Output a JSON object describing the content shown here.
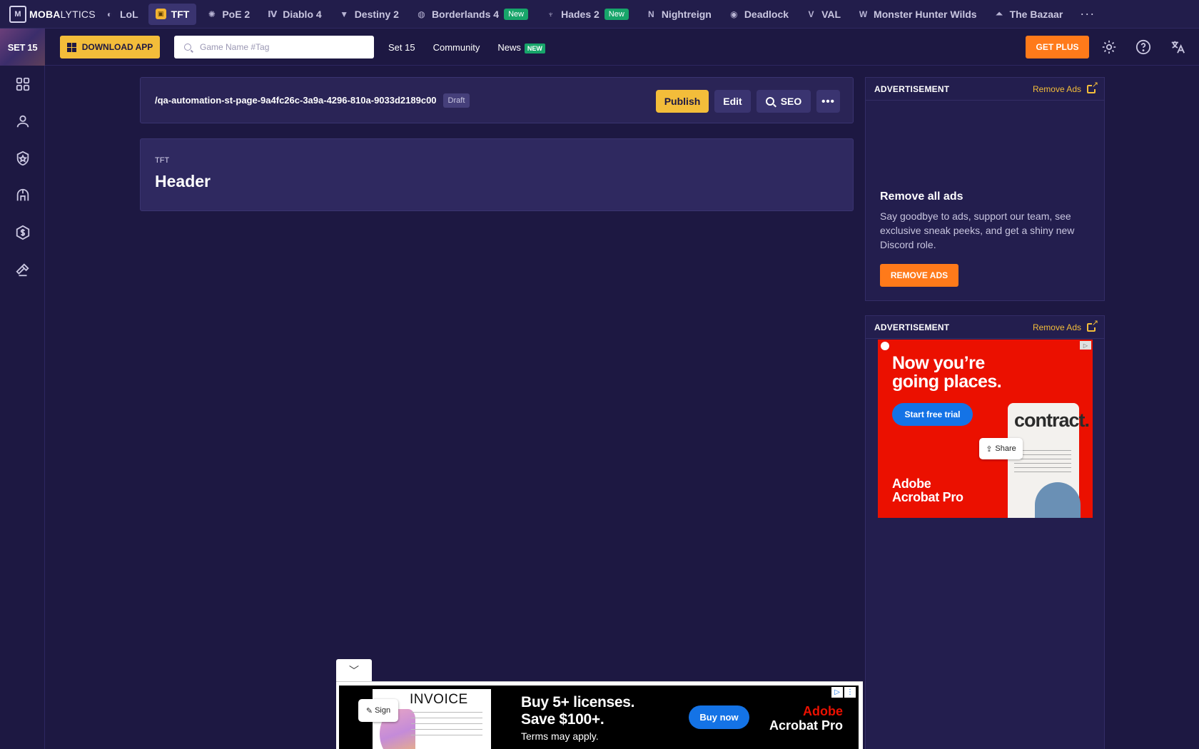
{
  "brand": {
    "bold": "MOBA",
    "light": "LYTICS"
  },
  "games": [
    {
      "label": "LoL",
      "icon": "lol-icon",
      "active": false
    },
    {
      "label": "TFT",
      "icon": "tft-icon",
      "active": true
    },
    {
      "label": "PoE 2",
      "icon": "poe2-icon",
      "active": false
    },
    {
      "label": "Diablo 4",
      "icon": "diablo4-icon",
      "active": false
    },
    {
      "label": "Destiny 2",
      "icon": "destiny2-icon",
      "active": false
    },
    {
      "label": "Borderlands 4",
      "icon": "borderlands4-icon",
      "badge": "New",
      "active": false
    },
    {
      "label": "Hades 2",
      "icon": "hades2-icon",
      "badge": "New",
      "active": false
    },
    {
      "label": "Nightreign",
      "icon": "nightreign-icon",
      "active": false
    },
    {
      "label": "Deadlock",
      "icon": "deadlock-icon",
      "active": false
    },
    {
      "label": "VAL",
      "icon": "valorant-icon",
      "active": false
    },
    {
      "label": "Monster Hunter Wilds",
      "icon": "monster-hunter-icon",
      "active": false
    },
    {
      "label": "The Bazaar",
      "icon": "bazaar-icon",
      "active": false
    }
  ],
  "subbar": {
    "set_badge": "SET 15",
    "download_label": "DOWNLOAD APP",
    "search_placeholder": "Game Name #Tag",
    "links": {
      "set": "Set 15",
      "community": "Community",
      "news": "News",
      "news_badge": "NEW"
    },
    "get_plus": "GET PLUS"
  },
  "page_bar": {
    "slug": "/qa-automation-st-page-9a4fc26c-3a9a-4296-810a-9033d2189c00",
    "status": "Draft",
    "publish": "Publish",
    "edit": "Edit",
    "seo": "SEO"
  },
  "header_block": {
    "kicker": "TFT",
    "title": "Header"
  },
  "ads": {
    "label": "ADVERTISEMENT",
    "remove_link": "Remove Ads",
    "remove_title": "Remove all ads",
    "remove_text": "Say goodbye to ads, support our team, see exclusive sneak peeks, and get a shiny new Discord role.",
    "remove_button": "REMOVE ADS",
    "adobe_square": {
      "headline": "Now you’re going places.",
      "cta": "Start free trial",
      "doc_word": "contract.",
      "share": "Share",
      "brand": "Adobe Acrobat Pro"
    },
    "adobe_banner": {
      "invoice": "INVOICE",
      "sign": "Sign",
      "headline": "Buy 5+ licenses. Save $100+.",
      "terms": "Terms may apply.",
      "cta": "Buy now",
      "brand_top": "Adobe",
      "brand_bottom": "Acrobat Pro"
    }
  },
  "colors": {
    "bg": "#1d1842",
    "accent_yellow": "#f3bd3a",
    "accent_orange": "#ff7a1a",
    "new_green": "#17a56a",
    "adobe_red": "#eb1000"
  }
}
